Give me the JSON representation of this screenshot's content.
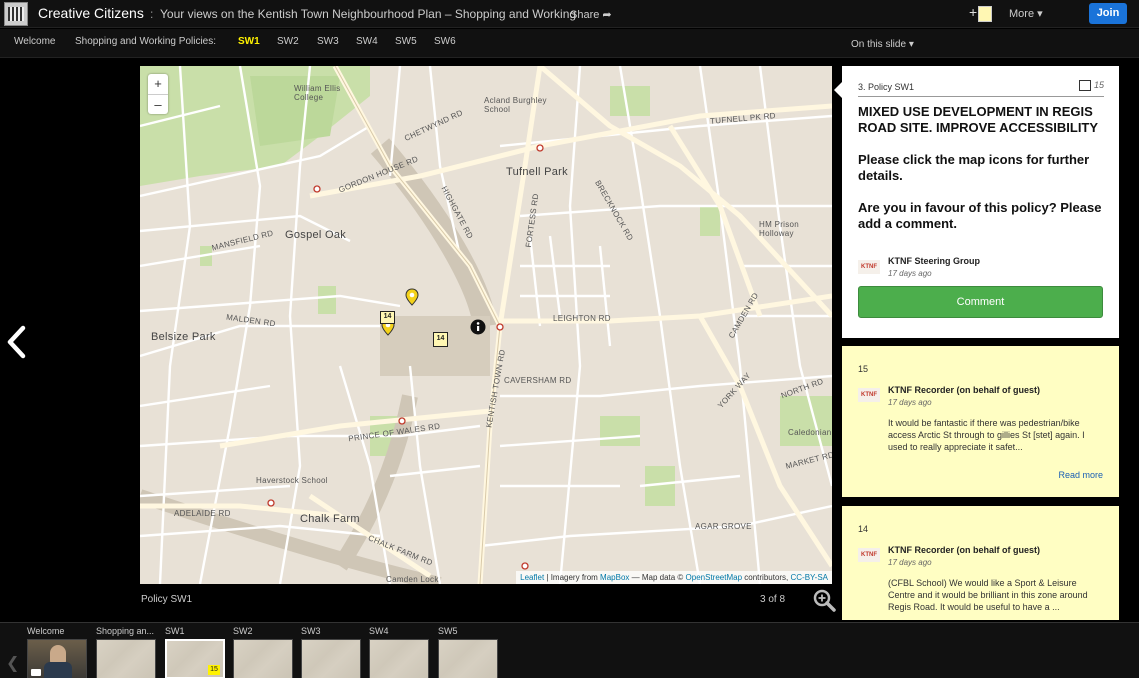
{
  "header": {
    "site_title": "Creative Citizens",
    "separator": ":",
    "page_title": "Your views on the Kentish Town Neighbourhood Plan – Shopping and Working",
    "share_label": "Share",
    "more_label": "More",
    "join_label": "Join"
  },
  "nav": {
    "welcome": "Welcome",
    "section_label": "Shopping and Working Policies:",
    "tabs": [
      "SW1",
      "SW2",
      "SW3",
      "SW4",
      "SW5",
      "SW6"
    ],
    "active_tab": "SW1",
    "on_this_slide": "On this slide"
  },
  "map": {
    "labels": {
      "william_ellis": "William Ellis\nCollege",
      "acland": "Acland Burghley\nSchool",
      "tufnell_park": "Tufnell Park",
      "gospel_oak": "Gospel Oak",
      "belsize_park": "Belsize Park",
      "hm_prison": "HM Prison\nHolloway",
      "caledonian": "Caledonian Pa",
      "haverstock": "Haverstock School",
      "chalk_farm": "Chalk Farm",
      "camden_lock": "Camden Lock",
      "gordon_house": "GORDON HOUSE RD",
      "mansfield": "MANSFIELD RD",
      "malden": "MALDEN RD",
      "tufnell_pk_rd": "TUFNELL PK RD",
      "leighton": "LEIGHTON RD",
      "caversham": "CAVERSHAM RD",
      "prince_of_wales": "PRINCE OF WALES RD",
      "kentish_town": "KENTISH TOWN RD",
      "highgate": "HIGHGATE RD",
      "fortess": "FORTESS RD",
      "adelaide": "ADELAIDE RD",
      "agar": "AGAR GROVE",
      "chalk_farm_rd": "CHALK FARM RD",
      "north_rd": "NORTH RD",
      "market_rd": "MARKET RD",
      "york_way": "YORK WAY",
      "camden_rd": "CAMDEN RD",
      "chetwynd": "CHETWYND RD",
      "brecknock": "BRECKNOCK RD"
    },
    "attribution": {
      "leaflet": "Leaflet",
      "imagery": " | Imagery from ",
      "mapbox": "MapBox",
      "mapdata": " — Map data © ",
      "osm": "OpenStreetMap",
      "contrib": " contributors, ",
      "license": "CC-BY-SA"
    },
    "markers": {
      "marker_a": "14",
      "marker_b": "14"
    }
  },
  "slide": {
    "caption": "Policy SW1",
    "page_count": "3 of 8"
  },
  "policy": {
    "number": "3. Policy SW1",
    "comment_count": "15",
    "heading": "MIXED USE DEVELOPMENT IN REGIS ROAD SITE. IMPROVE ACCESSIBILITY",
    "body1": "Please click the map icons for further details.",
    "body2": "Are you in favour of this policy? Please add a comment.",
    "author": "KTNF Steering Group",
    "posted": "17 days ago",
    "comment_button": "Comment",
    "avatar_text": "KTNF"
  },
  "comments": [
    {
      "number": "15",
      "author": "KTNF Recorder (on behalf of guest)",
      "posted": "17 days ago",
      "text": "It would be fantastic if there was pedestrian/bike access Arctic St through to gillies St [stet] again. I used to really appreciate it safet...",
      "read_more": "Read more"
    },
    {
      "number": "14",
      "author": "KTNF Recorder (on behalf of guest)",
      "posted": "17 days ago",
      "text": "(CFBL School) We would like a Sport & Leisure Centre and it would be brilliant in this zone around Regis Road. It would be useful to have a ..."
    }
  ],
  "filmstrip": {
    "items": [
      "Welcome",
      "Shopping an...",
      "SW1",
      "SW2",
      "SW3",
      "SW4",
      "SW5"
    ],
    "active_thumb_marker": "15"
  },
  "colors": {
    "accent_active_tab": "#fff200",
    "join_button": "#1a73d9",
    "comment_button": "#4cae4c",
    "note_bg": "#fffec3"
  }
}
